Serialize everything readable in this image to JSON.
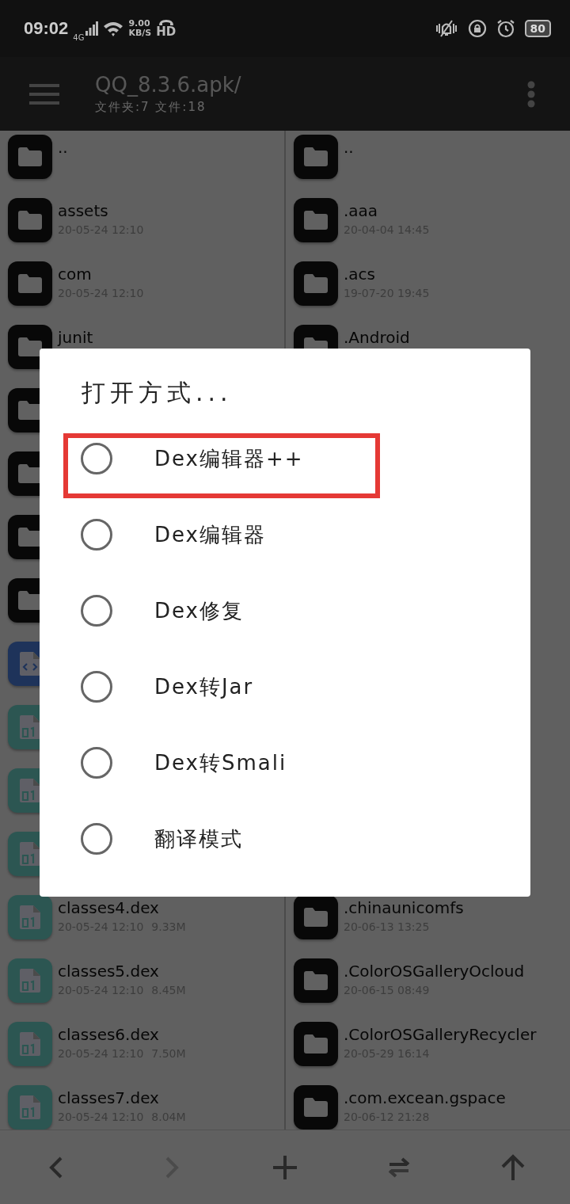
{
  "status_bar": {
    "time": "09:02",
    "network": "4G",
    "speed": "9.00",
    "speed_unit": "KB/S",
    "hd": "HD",
    "battery": "80"
  },
  "toolbar": {
    "title": "QQ_8.3.6.apk/",
    "subtitle": "文件夹:7 文件:18"
  },
  "left_pane": {
    "items": [
      {
        "kind": "folder",
        "name": ".."
      },
      {
        "kind": "folder",
        "name": "assets",
        "date": "20-05-24 12:10"
      },
      {
        "kind": "folder",
        "name": "com",
        "date": "20-05-24 12:10"
      },
      {
        "kind": "folder",
        "name": "junit"
      },
      {
        "kind": "folder"
      },
      {
        "kind": "folder"
      },
      {
        "kind": "folder"
      },
      {
        "kind": "folder"
      },
      {
        "kind": "xml"
      },
      {
        "kind": "dex"
      },
      {
        "kind": "dex"
      },
      {
        "kind": "dex"
      },
      {
        "kind": "dex",
        "name": "classes4.dex",
        "date": "20-05-24 12:10",
        "size": "9.33M"
      },
      {
        "kind": "dex",
        "name": "classes5.dex",
        "date": "20-05-24 12:10",
        "size": "8.45M"
      },
      {
        "kind": "dex",
        "name": "classes6.dex",
        "date": "20-05-24 12:10",
        "size": "7.50M"
      },
      {
        "kind": "dex",
        "name": "classes7.dex",
        "date": "20-05-24 12:10",
        "size": "8.04M"
      }
    ]
  },
  "right_pane": {
    "top": [
      {
        "kind": "folder",
        "name": ".."
      },
      {
        "kind": "folder",
        "name": ".aaa",
        "date": "20-04-04 14:45"
      },
      {
        "kind": "folder",
        "name": ".acs",
        "date": "19-07-20 19:45"
      },
      {
        "kind": "folder",
        "name": ".Android"
      }
    ],
    "bottom": [
      {
        "kind": "folder",
        "name": ".chinaunicomfs",
        "date": "20-06-13 13:25"
      },
      {
        "kind": "folder",
        "name": ".ColorOSGalleryOcloud",
        "date": "20-06-15 08:49"
      },
      {
        "kind": "folder",
        "name": ".ColorOSGalleryRecycler",
        "date": "20-05-29 16:14"
      },
      {
        "kind": "folder",
        "name": ".com.excean.gspace",
        "date": "20-06-12 21:28"
      }
    ]
  },
  "bottom_bar": [
    {
      "kind": "back",
      "disabled": false
    },
    {
      "kind": "forward",
      "disabled": true
    },
    {
      "kind": "add",
      "disabled": false
    },
    {
      "kind": "swap",
      "disabled": false
    },
    {
      "kind": "up",
      "disabled": false
    }
  ],
  "dialog": {
    "title": "打开方式...",
    "options": [
      {
        "label": "Dex编辑器++",
        "selected": false,
        "highlighted": true
      },
      {
        "label": "Dex编辑器",
        "selected": false,
        "highlighted": false
      },
      {
        "label": "Dex修复",
        "selected": false,
        "highlighted": false
      },
      {
        "label": "Dex转Jar",
        "selected": false,
        "highlighted": false
      },
      {
        "label": "Dex转Smali",
        "selected": false,
        "highlighted": false
      },
      {
        "label": "翻译模式",
        "selected": false,
        "highlighted": false
      }
    ]
  }
}
